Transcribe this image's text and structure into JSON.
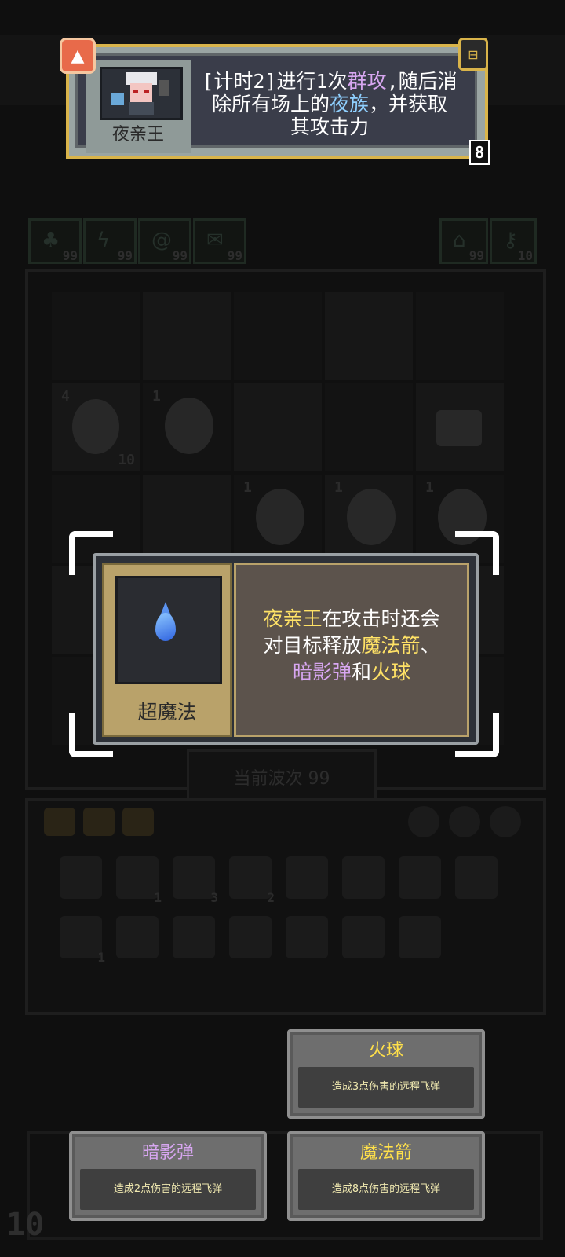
{
  "header_card": {
    "character_name": "夜亲王",
    "ability_line1_pre": "[计时2]进行1次",
    "ability_kw1": "群攻",
    "ability_line1_post": ",随后消",
    "ability_line2_pre": "除所有场上的",
    "ability_kw2": "夜族",
    "ability_line2_post": "，并获取",
    "ability_line3": "其攻击力",
    "page_indicator": "8"
  },
  "stats": [
    {
      "icon": "leaf-icon",
      "value": "99"
    },
    {
      "icon": "bolt-icon",
      "value": "99"
    },
    {
      "icon": "swirl-icon",
      "value": "99"
    },
    {
      "icon": "mail-icon",
      "value": "99"
    },
    {
      "icon": "house-icon",
      "value": "99"
    },
    {
      "icon": "key-icon",
      "value": "10"
    }
  ],
  "board": {
    "wave_label": "当前波次 99",
    "unit_badges": [
      "4",
      "10",
      "1",
      "1",
      "1",
      "1"
    ]
  },
  "item_popup": {
    "item_name": "超魔法",
    "desc_part1": "夜亲王",
    "desc_part2": "在攻击时还会",
    "desc_part3": "对目标释放",
    "desc_part4": "魔法箭",
    "desc_part5": "、",
    "desc_part6": "暗影弹",
    "desc_part7": "和",
    "desc_part8": "火球"
  },
  "choices": [
    {
      "title": "火球",
      "desc": "造成3点伤害的远程飞弹",
      "color": "#ffe04a"
    },
    {
      "title": "暗影弹",
      "desc": "造成2点伤害的远程飞弹",
      "color": "#d7a6f0"
    },
    {
      "title": "魔法箭",
      "desc": "造成8点伤害的远程飞弹",
      "color": "#ffe04a"
    }
  ],
  "level": "10",
  "inventory_counts": [
    "1",
    "3",
    "2",
    "1"
  ]
}
